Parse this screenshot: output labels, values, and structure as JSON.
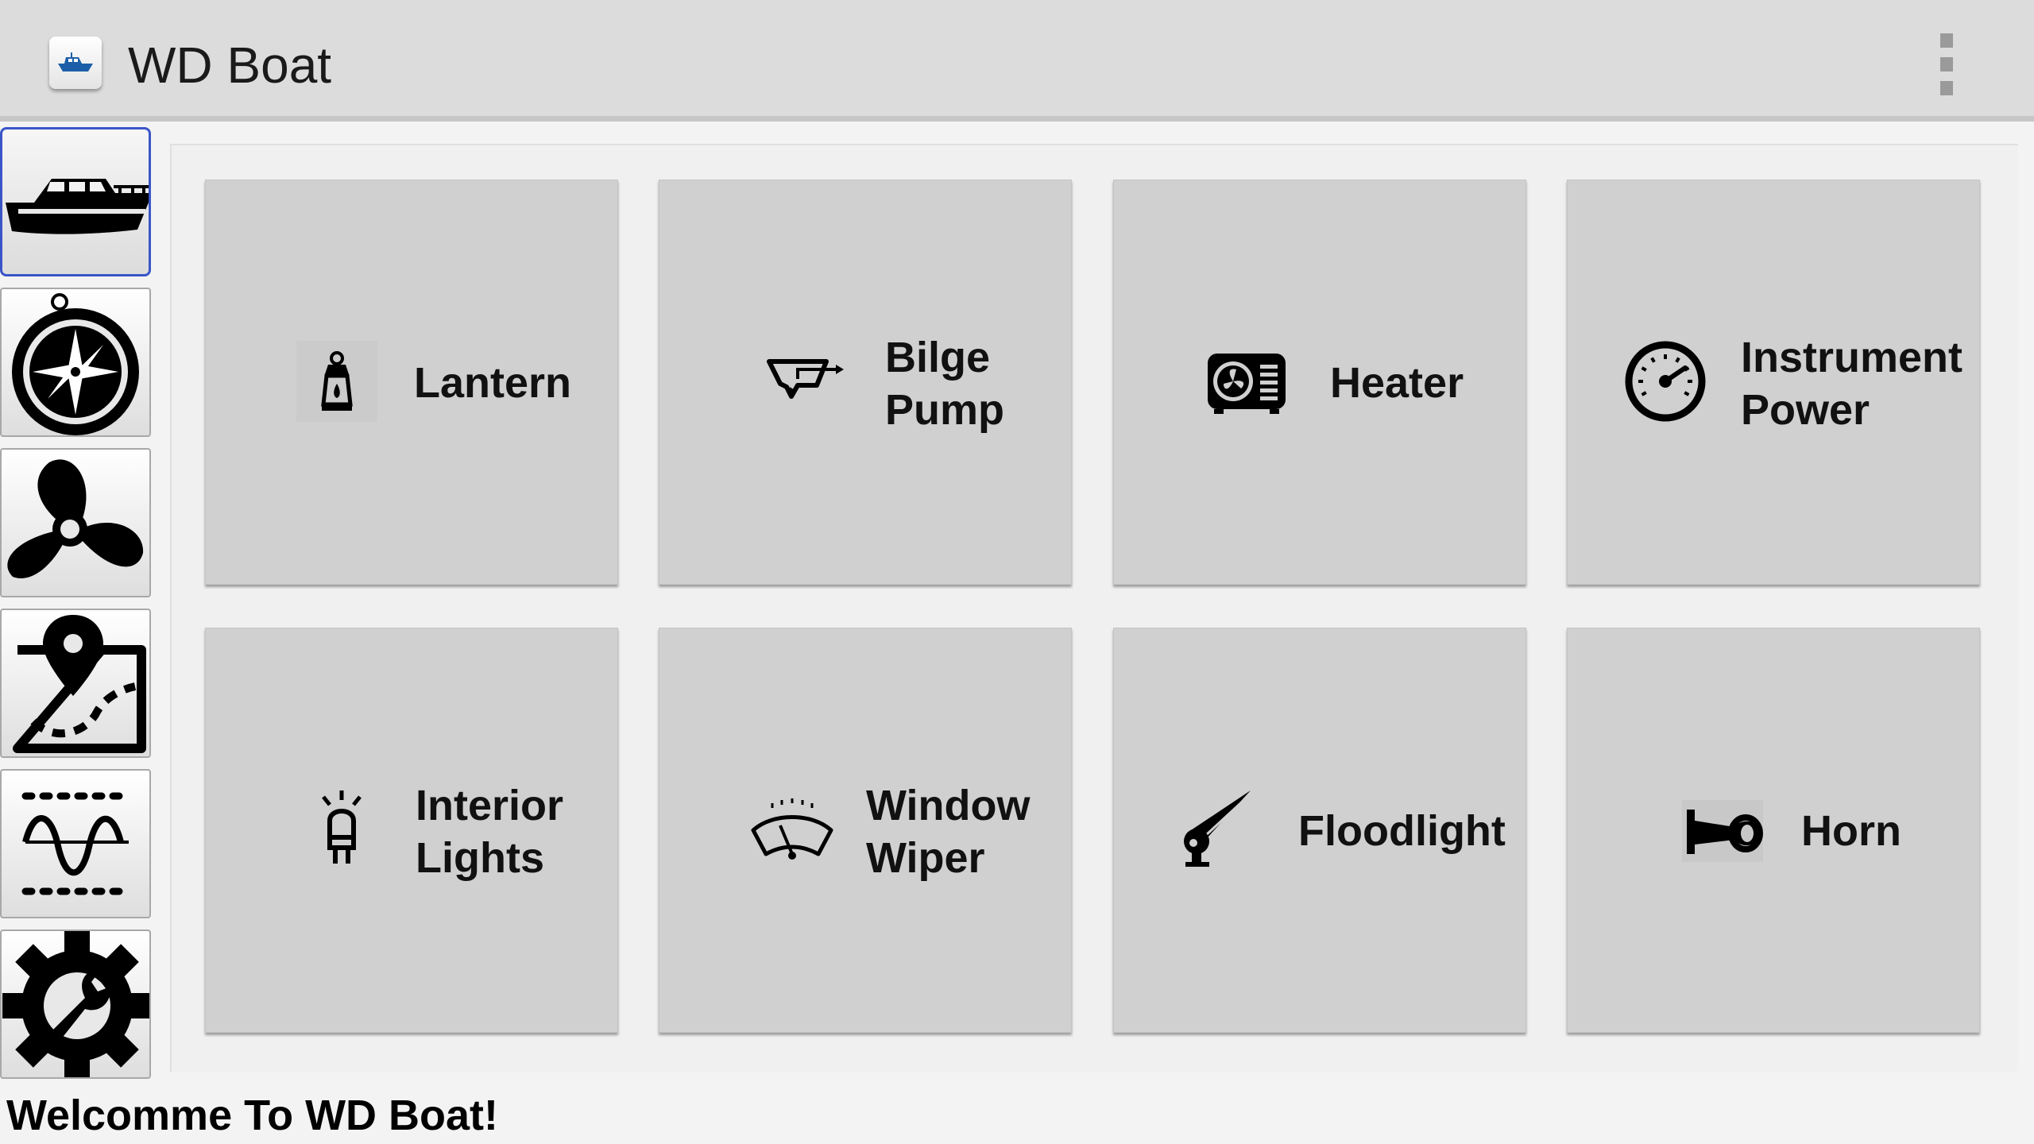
{
  "header": {
    "title": "WD Boat",
    "app_icon": "boat-app-icon",
    "overflow_icon": "overflow-menu-icon"
  },
  "sidebar": {
    "items": [
      {
        "icon": "boat-icon",
        "selected": true
      },
      {
        "icon": "compass-icon",
        "selected": false
      },
      {
        "icon": "propeller-icon",
        "selected": false
      },
      {
        "icon": "map-route-icon",
        "selected": false
      },
      {
        "icon": "sensor-wave-icon",
        "selected": false
      },
      {
        "icon": "settings-wrench-icon",
        "selected": false
      }
    ]
  },
  "tiles": [
    {
      "icon": "lantern-icon",
      "line1": "Lantern",
      "line2": ""
    },
    {
      "icon": "bilge-pump-icon",
      "line1": "Bilge",
      "line2": "Pump"
    },
    {
      "icon": "heater-icon",
      "line1": "Heater",
      "line2": ""
    },
    {
      "icon": "gauge-icon",
      "line1": "Instrument",
      "line2": "Power"
    },
    {
      "icon": "interior-light-icon",
      "line1": "Interior",
      "line2": "Lights"
    },
    {
      "icon": "window-wiper-icon",
      "line1": "Window",
      "line2": "Wiper"
    },
    {
      "icon": "floodlight-icon",
      "line1": "Floodlight",
      "line2": ""
    },
    {
      "icon": "horn-icon",
      "line1": "Horn",
      "line2": ""
    }
  ],
  "footer": {
    "message": "Welcomme To WD Boat!"
  },
  "colors": {
    "actionbar": "#dcdcdc",
    "tile": "#d0d0d0",
    "selected_border": "#3a55c8"
  }
}
